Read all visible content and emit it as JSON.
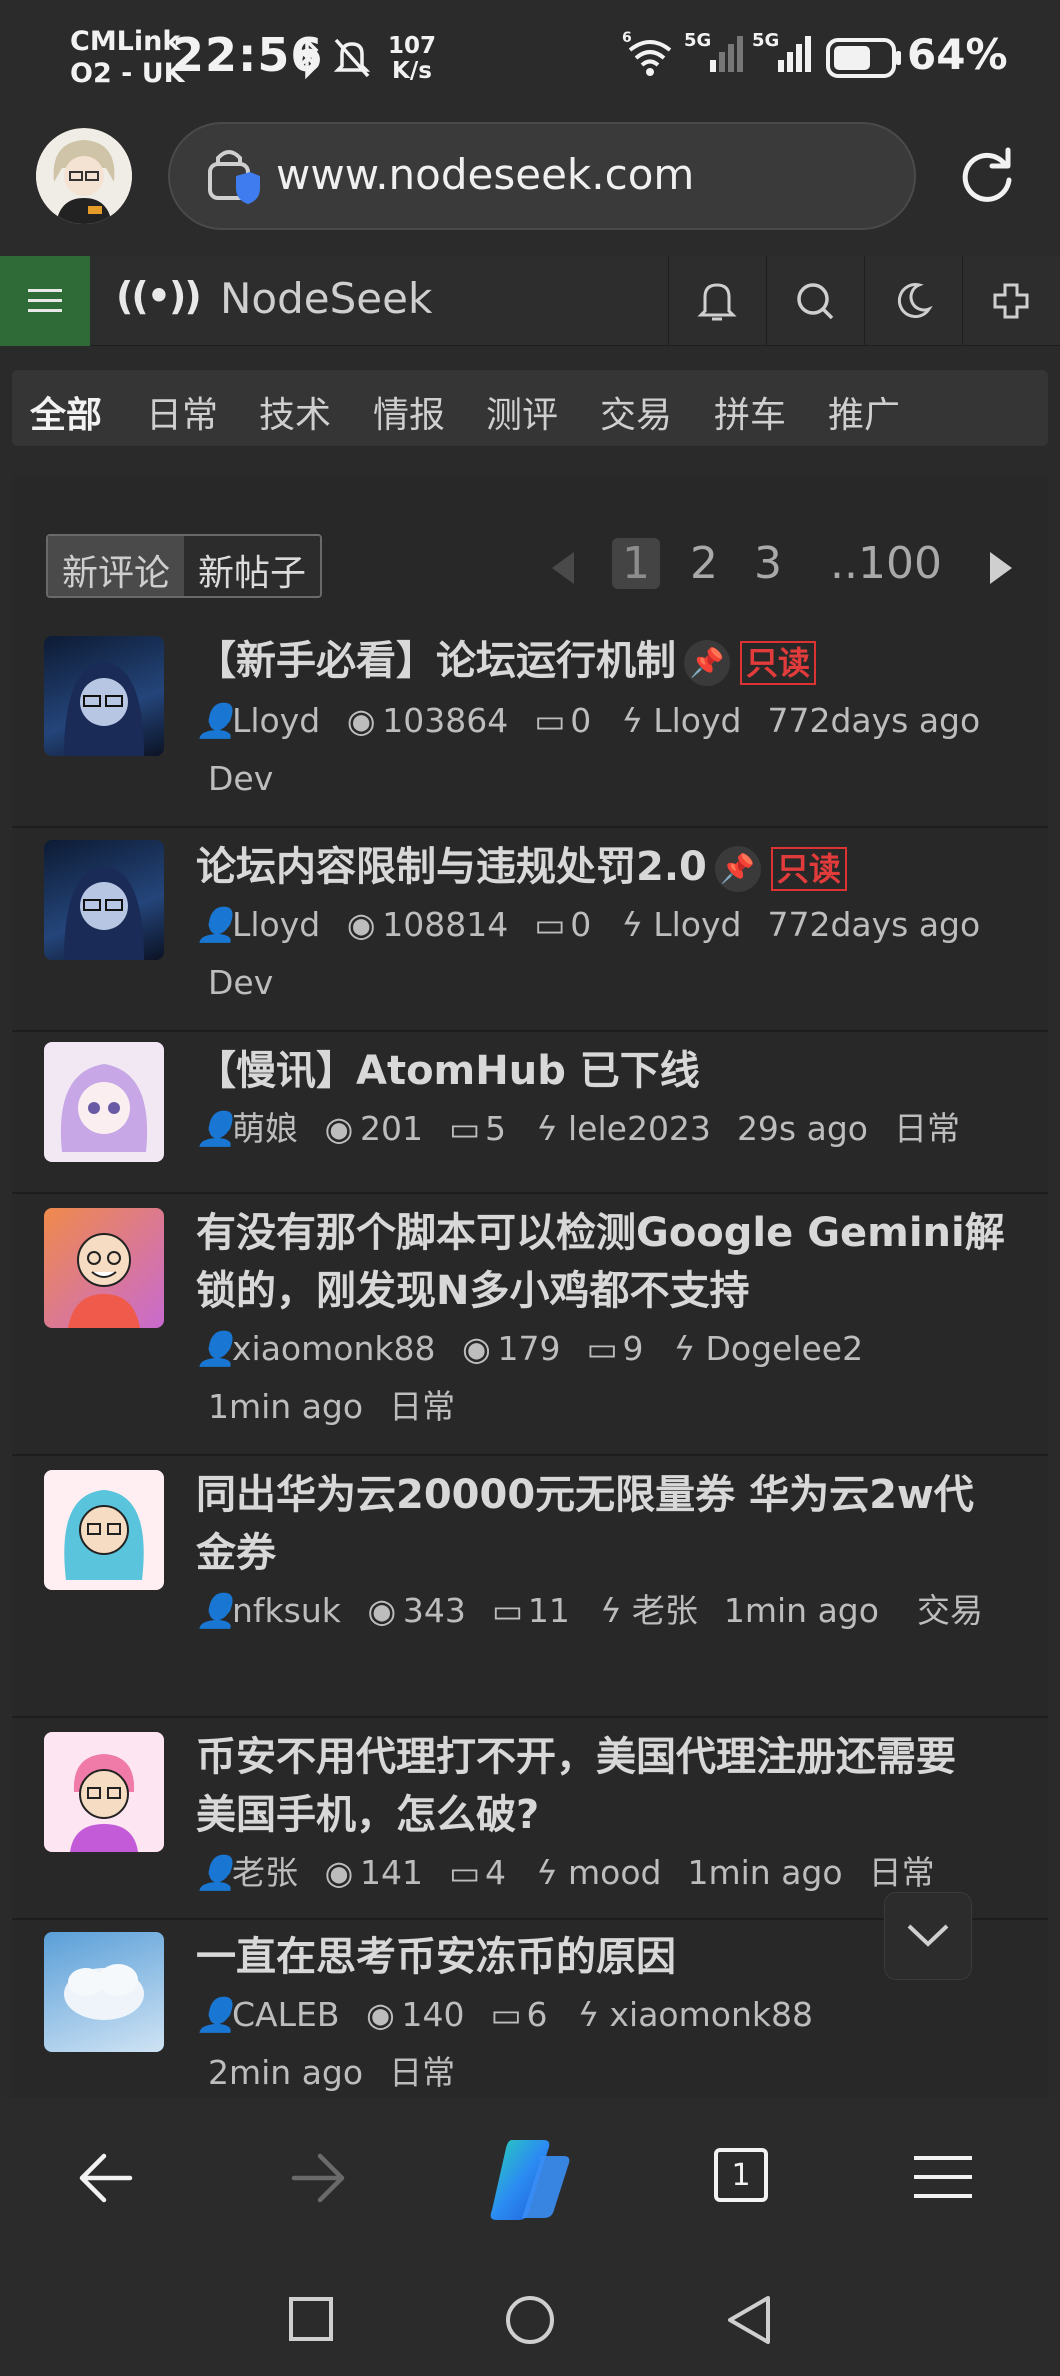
{
  "status_bar": {
    "carrier_line1": "CMLink",
    "carrier_line2": "O2 - UK",
    "time": "22:56",
    "net_speed_value": "107",
    "net_speed_unit": "K/s",
    "signal_label_1": "5G",
    "signal_label_2": "5G",
    "wifi_label": "6",
    "battery": "64%"
  },
  "browser": {
    "url": "www.nodeseek.com"
  },
  "site_nav": {
    "logo_glyph": "((•))",
    "logo_text": "NodeSeek"
  },
  "categories": [
    "全部",
    "日常",
    "技术",
    "情报",
    "测评",
    "交易",
    "拼车",
    "推广"
  ],
  "sort": {
    "option_1": "新评论",
    "option_2": "新帖子"
  },
  "pagination": {
    "current": "1",
    "p2": "2",
    "p3": "3",
    "last": "..100"
  },
  "posts": [
    {
      "title": "【新手必看】论坛运行机制",
      "pinned": true,
      "readonly": "只读",
      "author": "Lloyd",
      "views": "103864",
      "comments": "0",
      "last_reply": "Lloyd",
      "time": "772days ago",
      "category": "Dev"
    },
    {
      "title": "论坛内容限制与违规处罚2.0",
      "pinned": true,
      "readonly": "只读",
      "author": "Lloyd",
      "views": "108814",
      "comments": "0",
      "last_reply": "Lloyd",
      "time": "772days ago",
      "category": "Dev"
    },
    {
      "title": "【慢讯】AtomHub 已下线",
      "author": "萌娘",
      "views": "201",
      "comments": "5",
      "last_reply": "lele2023",
      "time": "29s ago",
      "category": "日常"
    },
    {
      "title_line1": "有没有那个脚本可以检测Google Gemini解",
      "title_line2": "锁的，刚发现N多小鸡都不支持",
      "author": "xiaomonk88",
      "views": "179",
      "comments": "9",
      "last_reply": "Dogelee2",
      "time": "1min ago",
      "category": "日常"
    },
    {
      "title_line1": "同出华为云20000元无限量券 华为云2w代",
      "title_line2": "金券",
      "author": "nfksuk",
      "views": "343",
      "comments": "11",
      "last_reply": "老张",
      "time": "1min ago",
      "category": "交易"
    },
    {
      "title_line1": "币安不用代理打不开，美国代理注册还需要",
      "title_line2": "美国手机，怎么破?",
      "author": "老张",
      "views": "141",
      "comments": "4",
      "last_reply": "mood",
      "time": "1min ago",
      "category": "日常"
    },
    {
      "title": "一直在思考币安冻币的原因",
      "author": "CALEB",
      "views": "140",
      "comments": "6",
      "last_reply": "xiaomonk88",
      "time": "2min ago",
      "category": "日常"
    }
  ],
  "bottom_bar": {
    "tab_count": "1"
  },
  "icons": {
    "status": [
      "bluetooth-icon",
      "mute-bell-icon",
      "wifi-icon",
      "signal-icon",
      "battery-icon"
    ],
    "browser": [
      "profile-avatar",
      "lock-shield-icon",
      "reload-icon"
    ],
    "site": [
      "hamburger-icon",
      "bell-icon",
      "search-icon",
      "moon-icon",
      "plus-icon"
    ],
    "meta": [
      "user-icon",
      "eye-icon",
      "comment-icon",
      "bolt-icon",
      "pin-icon"
    ],
    "bottom": [
      "back-icon",
      "forward-icon",
      "copilot-icon",
      "tabs-icon",
      "menu-icon",
      "square-icon",
      "circle-icon",
      "triangle-back-icon",
      "chevron-down-icon"
    ]
  },
  "colors": {
    "menu_button_bg": "#2f6b36",
    "readonly_red": "#e23b3b",
    "page_bg": "#2a2a2a"
  }
}
